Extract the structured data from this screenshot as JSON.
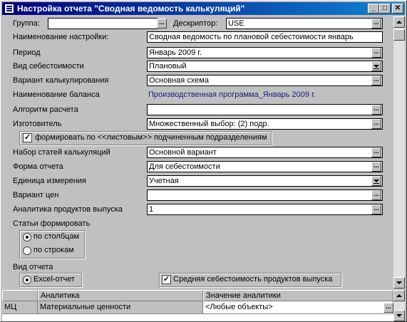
{
  "window": {
    "title": "Настройка отчета \"Сводная ведомость калькуляций\"",
    "min_btn": "_",
    "max_btn": "□",
    "close_btn": "✕"
  },
  "form": {
    "group_label": "Группа:",
    "group_value": "",
    "descriptor_label": "Дескриптор:",
    "descriptor_value": "USE",
    "setting_name_label": "Наименование настройки:",
    "setting_name_value": "Сводная ведомость по плановой себестоимости январь",
    "period_label": "Период",
    "period_value": "Январь 2009 г.",
    "cost_type_label": "Вид себестоимости",
    "cost_type_value": "Плановый",
    "calc_variant_label": "Вариант калькулирования",
    "calc_variant_value": "Основная схема",
    "balance_name_label": "Наименование баланса",
    "balance_name_value": "Производственная программа_Январь 2009 г.",
    "algorithm_label": "Алгоритм расчета",
    "algorithm_value": "",
    "manufacturer_label": "Изготовитель",
    "manufacturer_value": "Множественный выбор: (2) подр.",
    "sheet_subdivisions_label": "формировать по <<листовым>> подчиненным подразделениям",
    "sheet_subdivisions_checked": true,
    "cost_items_set_label": "Набор статей калькуляций",
    "cost_items_set_value": "Основной вариант",
    "report_form_label": "Форма отчета",
    "report_form_value": "Для себестоимости",
    "unit_label": "Единица измерения",
    "unit_value": "Учетная",
    "price_variant_label": "Вариант цен",
    "price_variant_value": "",
    "product_analytics_label": "Аналитика продуктов выпуска",
    "product_analytics_value": "1",
    "items_form_label": "Статьи формировать",
    "by_columns_label": "по столбцам",
    "by_rows_label": "по строкам",
    "items_form_selected": "по столбцам",
    "report_type_label": "Вид отчета",
    "excel_report_label": "Excel-отчет",
    "avg_cost_label": "Средняя себестоимость продуктов выпуска",
    "avg_cost_checked": true,
    "ellipsis": "..."
  },
  "grid": {
    "columns": [
      "",
      "Аналитика",
      "Значение аналитики"
    ],
    "rows": [
      {
        "code": "МЦ",
        "analytics": "Материальные ценности",
        "value": "<Любые объекты>"
      }
    ]
  }
}
